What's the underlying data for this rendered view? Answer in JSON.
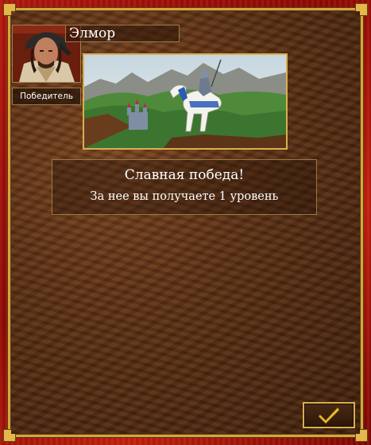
{
  "hero": {
    "name": "Элмор",
    "title": "Победитель",
    "portrait_icon": "hero-portrait-icon"
  },
  "scene": {
    "icon": "knight-on-white-horse-scene"
  },
  "message": {
    "title": "Славная победа!",
    "body": "За нее вы получаете 1 уровень"
  },
  "ok_button": {
    "icon": "checkmark-icon"
  },
  "colors": {
    "frame_red": "#b2170f",
    "gold": "#d4a640",
    "parchment": "#5a2f14",
    "text": "#ffffff",
    "checkmark": "#f2c230"
  }
}
